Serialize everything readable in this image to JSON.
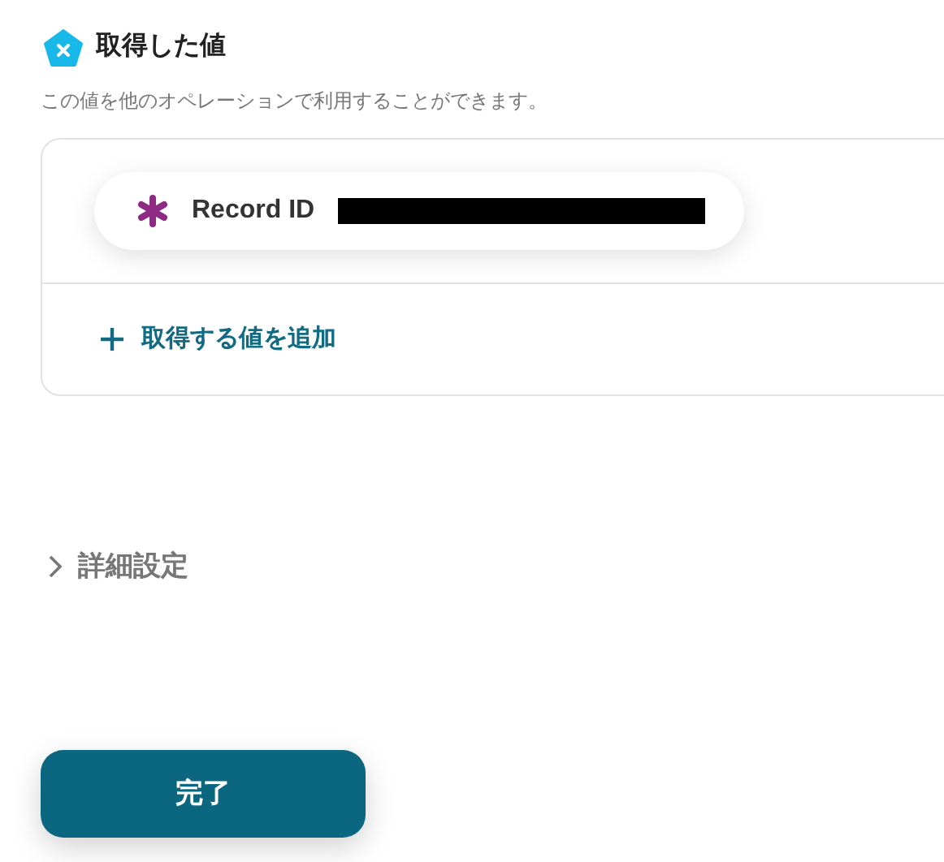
{
  "section": {
    "title": "取得した値",
    "description": "この値を他のオペレーションで利用することができます。"
  },
  "values": [
    {
      "label": "Record ID"
    }
  ],
  "add_button": {
    "label": "取得する値を追加"
  },
  "details": {
    "label": "詳細設定",
    "expanded": false
  },
  "done_button": {
    "label": "完了"
  }
}
